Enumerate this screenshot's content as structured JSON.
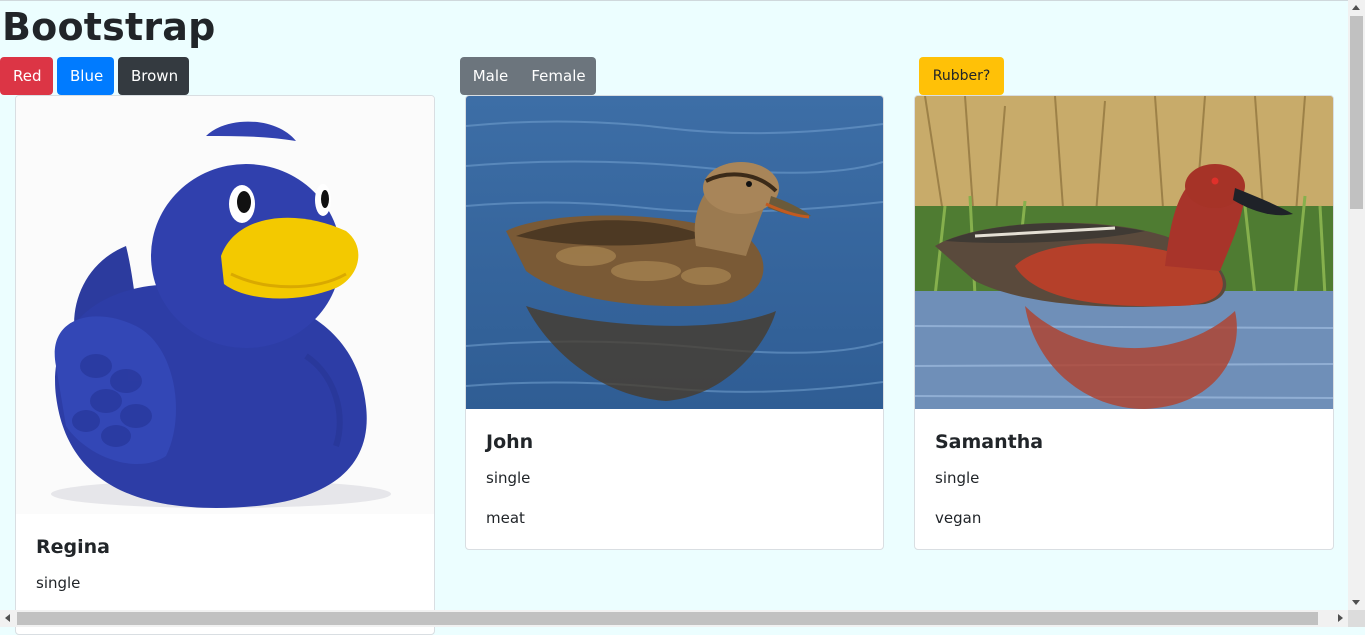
{
  "page": {
    "title": "Bootstrap"
  },
  "filters": {
    "color_buttons": [
      {
        "label": "Red",
        "color": "#dc3545"
      },
      {
        "label": "Blue",
        "color": "#007bff"
      },
      {
        "label": "Brown",
        "color": "#343a40"
      }
    ],
    "gender_group": [
      {
        "label": "Male"
      },
      {
        "label": "Female"
      }
    ],
    "rubber_button": {
      "label": "Rubber?",
      "color": "#ffc107"
    }
  },
  "cards": [
    {
      "name": "Regina",
      "status": "single",
      "image_icon": "rubber-duck-image"
    },
    {
      "name": "John",
      "status": "single",
      "diet": "meat",
      "image_icon": "mallard-duck-image"
    },
    {
      "name": "Samantha",
      "status": "single",
      "diet": "vegan",
      "image_icon": "cinnamon-teal-duck-image"
    }
  ],
  "colors": {
    "background": "#ecfeff",
    "group_button": "#6c757d"
  }
}
